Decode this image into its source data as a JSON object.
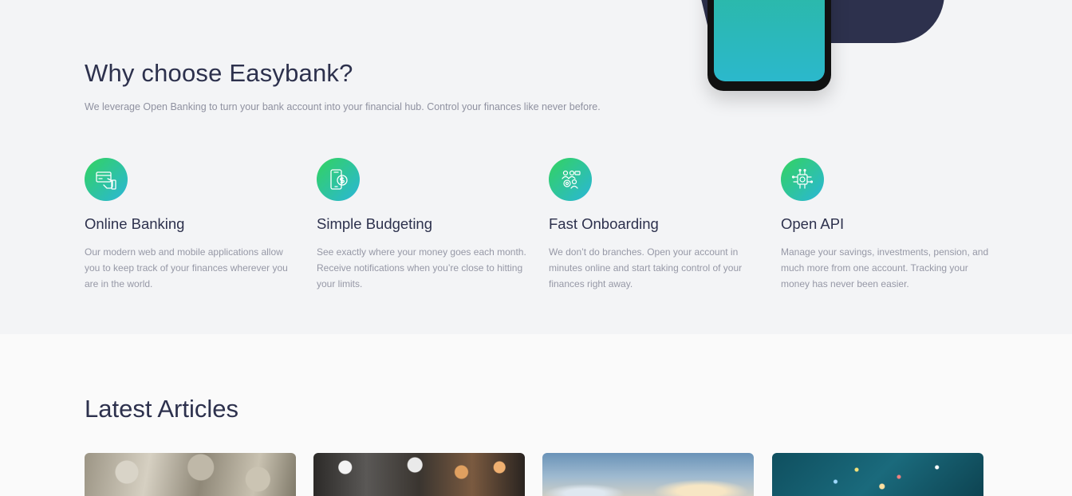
{
  "features_section": {
    "title": "Why choose Easybank?",
    "subtitle": "We leverage Open Banking to turn your bank account into your financial hub. Control your finances like never before.",
    "items": [
      {
        "icon": "online-banking-icon",
        "title": "Online Banking",
        "text": "Our modern web and mobile applications allow you to keep track of your finances wherever you are in the world."
      },
      {
        "icon": "budgeting-icon",
        "title": "Simple Budgeting",
        "text": "See exactly where your money goes each month. Receive notifications when you’re close to hitting your limits."
      },
      {
        "icon": "onboarding-icon",
        "title": "Fast Onboarding",
        "text": "We don’t do branches. Open your account in minutes online and start taking control of your finances right away."
      },
      {
        "icon": "api-icon",
        "title": "Open API",
        "text": "Manage your savings, investments, pension, and much more from one account. Tracking your money has never been easier."
      }
    ]
  },
  "articles_section": {
    "title": "Latest Articles"
  },
  "colors": {
    "navy": "#2d314d",
    "gradient_start": "#33d35e",
    "gradient_end": "#2ab6d9",
    "body_text": "#9698a6"
  }
}
